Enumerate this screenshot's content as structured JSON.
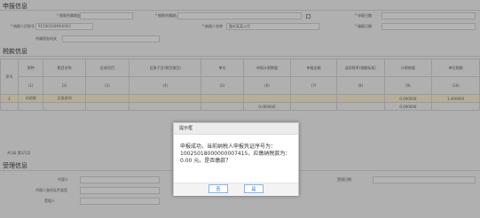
{
  "sections": {
    "declare_info": "申报信息",
    "tax_info": "税款信息",
    "accept_info": "受理信息"
  },
  "declare": {
    "row1": [
      "税款所属期起",
      "税款所属期止",
      "申报日期"
    ],
    "row2": [
      "纳税人识别号",
      "纳税人名称",
      "填报日期"
    ],
    "taxpayer_id": "91500106MA60K3",
    "taxpayer_name": "重庆某某公司",
    "row3": "所属税务机关"
  },
  "table": {
    "headers": [
      "序号",
      "税种",
      "税目名称",
      "征收项目",
      "征收子目(税目细目)",
      "单位",
      "申报计税数量",
      "申报金额",
      "适用税率(税额标准)",
      "计税依据",
      "单位税额"
    ],
    "indices": [
      "(1)",
      "(2)",
      "(3)",
      "(4)",
      "(5)",
      "(6)",
      "(7)",
      "(8)",
      "(9)",
      "(10)"
    ],
    "row1": {
      "num": "1",
      "tax": "印花税",
      "item": "买卖合同",
      "amount": "0.000000",
      "rate": "1.400000"
    },
    "row2": {
      "amount": "0.000000",
      "rate2": "0.000000"
    },
    "pager": "共1条 第1/1页"
  },
  "accept": {
    "agent_label": "代理人",
    "agent_id_label": "代理人身份证件类型",
    "accept_label": "受理人",
    "accept_date_label": "受理日期"
  },
  "dialog": {
    "title": "提示框",
    "message": "申报成功，当前纳税人申报凭证序号为：10025018000000007415，应缴纳税款为：0.00 元。是否缴款？",
    "no_label": "否",
    "yes_label": "是"
  }
}
